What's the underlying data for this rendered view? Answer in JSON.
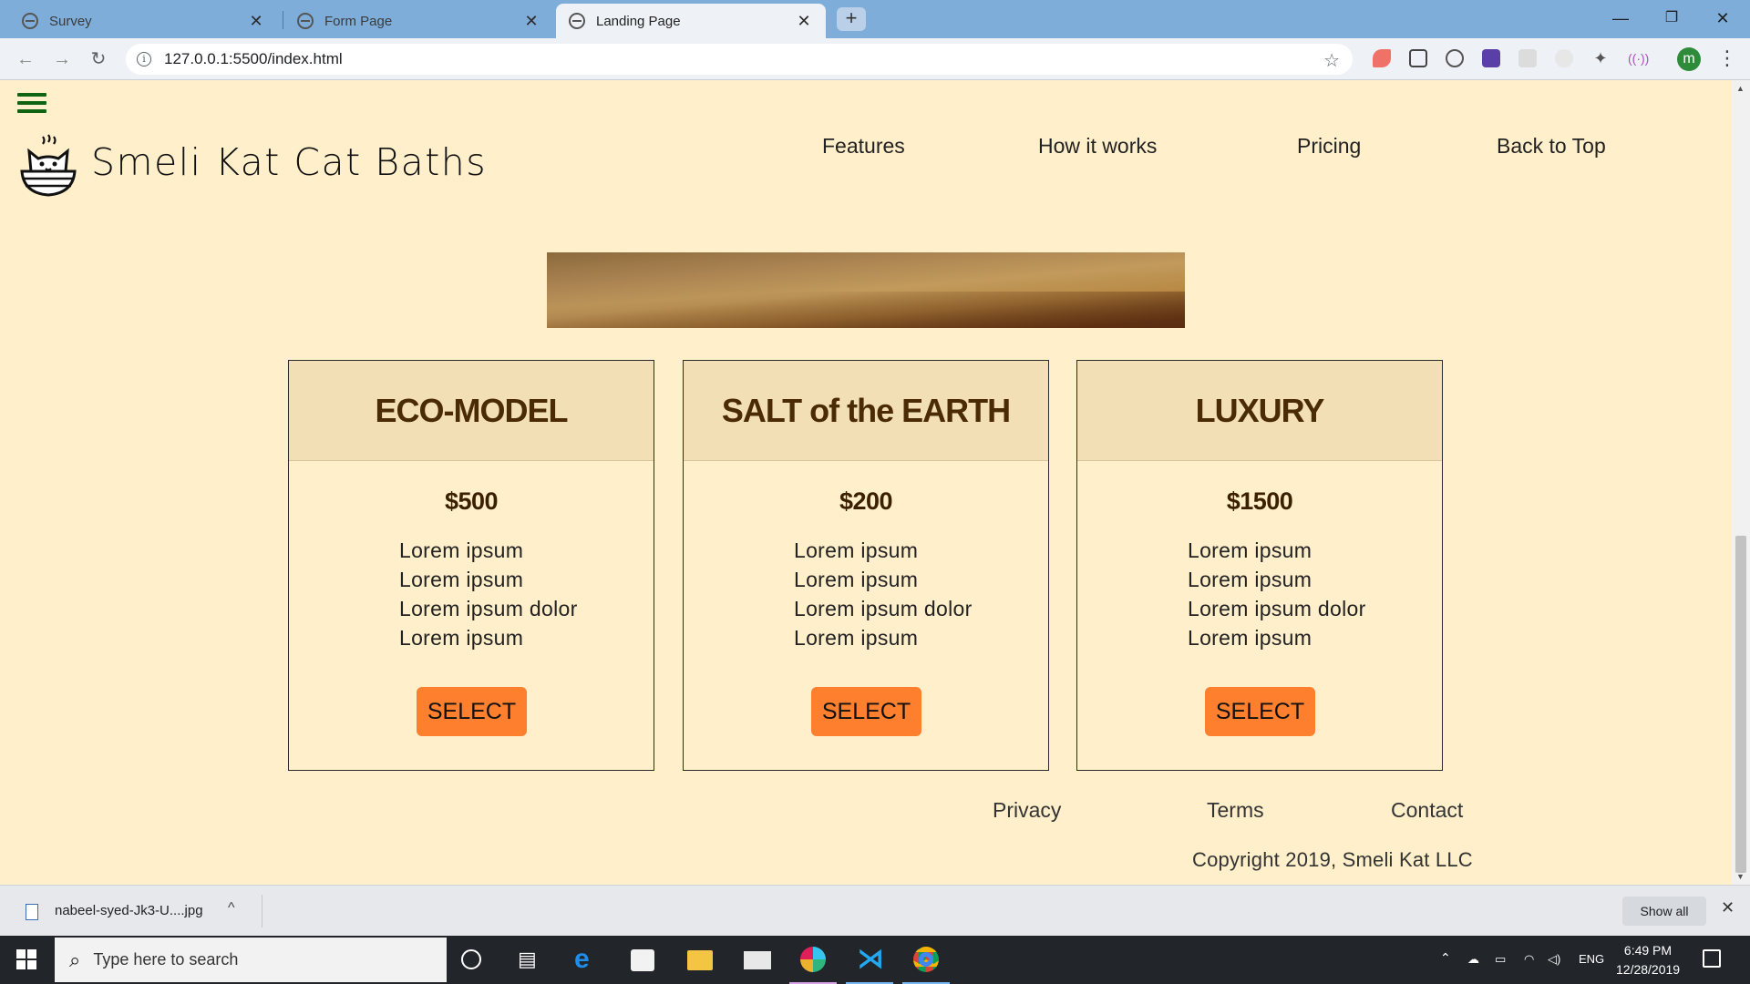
{
  "browser": {
    "tabs": [
      {
        "label": "Survey",
        "active": false
      },
      {
        "label": "Form Page",
        "active": false
      },
      {
        "label": "Landing Page",
        "active": true
      }
    ],
    "url": "127.0.0.1:5500/index.html",
    "profile_initial": "m"
  },
  "page": {
    "brand": "Smeli Kat Cat Baths",
    "nav": [
      "Features",
      "How it works",
      "Pricing",
      "Back to Top"
    ],
    "plans": [
      {
        "name": "ECO-MODEL",
        "price": "$500",
        "features": [
          "Lorem ipsum",
          "Lorem ipsum",
          "Lorem ipsum dolor",
          "Lorem ipsum"
        ],
        "button": "SELECT"
      },
      {
        "name": "SALT of the EARTH",
        "price": "$200",
        "features": [
          "Lorem ipsum",
          "Lorem ipsum",
          "Lorem ipsum dolor",
          "Lorem ipsum"
        ],
        "button": "SELECT"
      },
      {
        "name": "LUXURY",
        "price": "$1500",
        "features": [
          "Lorem ipsum",
          "Lorem ipsum",
          "Lorem ipsum dolor",
          "Lorem ipsum"
        ],
        "button": "SELECT"
      }
    ],
    "footer_links": [
      "Privacy",
      "Terms",
      "Contact"
    ],
    "copyright": "Copyright 2019, Smeli Kat LLC"
  },
  "downloads": {
    "file": "nabeel-syed-Jk3-U....jpg",
    "show_all": "Show all"
  },
  "taskbar": {
    "search_placeholder": "Type here to search",
    "language": "ENG",
    "time": "6:49 PM",
    "date": "12/28/2019"
  },
  "colors": {
    "page_bg": "#ffefca",
    "card_header": "#f2dfb6",
    "button": "#fe7f2d",
    "hamburger": "#0f6414",
    "tabbar": "#7fadd9"
  }
}
